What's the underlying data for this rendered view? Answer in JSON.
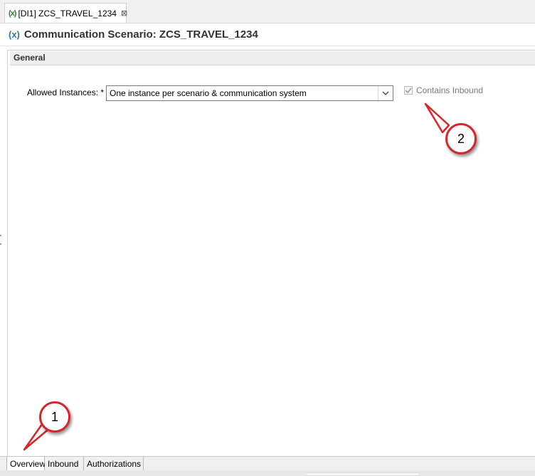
{
  "editor_tab": {
    "icon": "communication-scenario-icon",
    "label": "[DI1] ZCS_TRAVEL_1234",
    "close_glyph": "⊠"
  },
  "header": {
    "icon_text": "(x)",
    "title": "Communication Scenario: ZCS_TRAVEL_1234"
  },
  "general": {
    "section_title": "General",
    "allowed_instances_label": "Allowed Instances: *",
    "allowed_instances_value": "One instance per scenario & communication system",
    "contains_inbound_label": "Contains Inbound",
    "contains_inbound_checked": true,
    "contains_inbound_enabled": false
  },
  "callouts": [
    "1",
    "2"
  ],
  "bottom_tabs": [
    {
      "label": "Overview",
      "active": true
    },
    {
      "label": "Inbound",
      "active": false
    },
    {
      "label": "Authorizations",
      "active": false
    }
  ],
  "colors": {
    "callout_border": "#d6252b",
    "title_text": "#333333",
    "section_bg": "#eeeeee"
  }
}
